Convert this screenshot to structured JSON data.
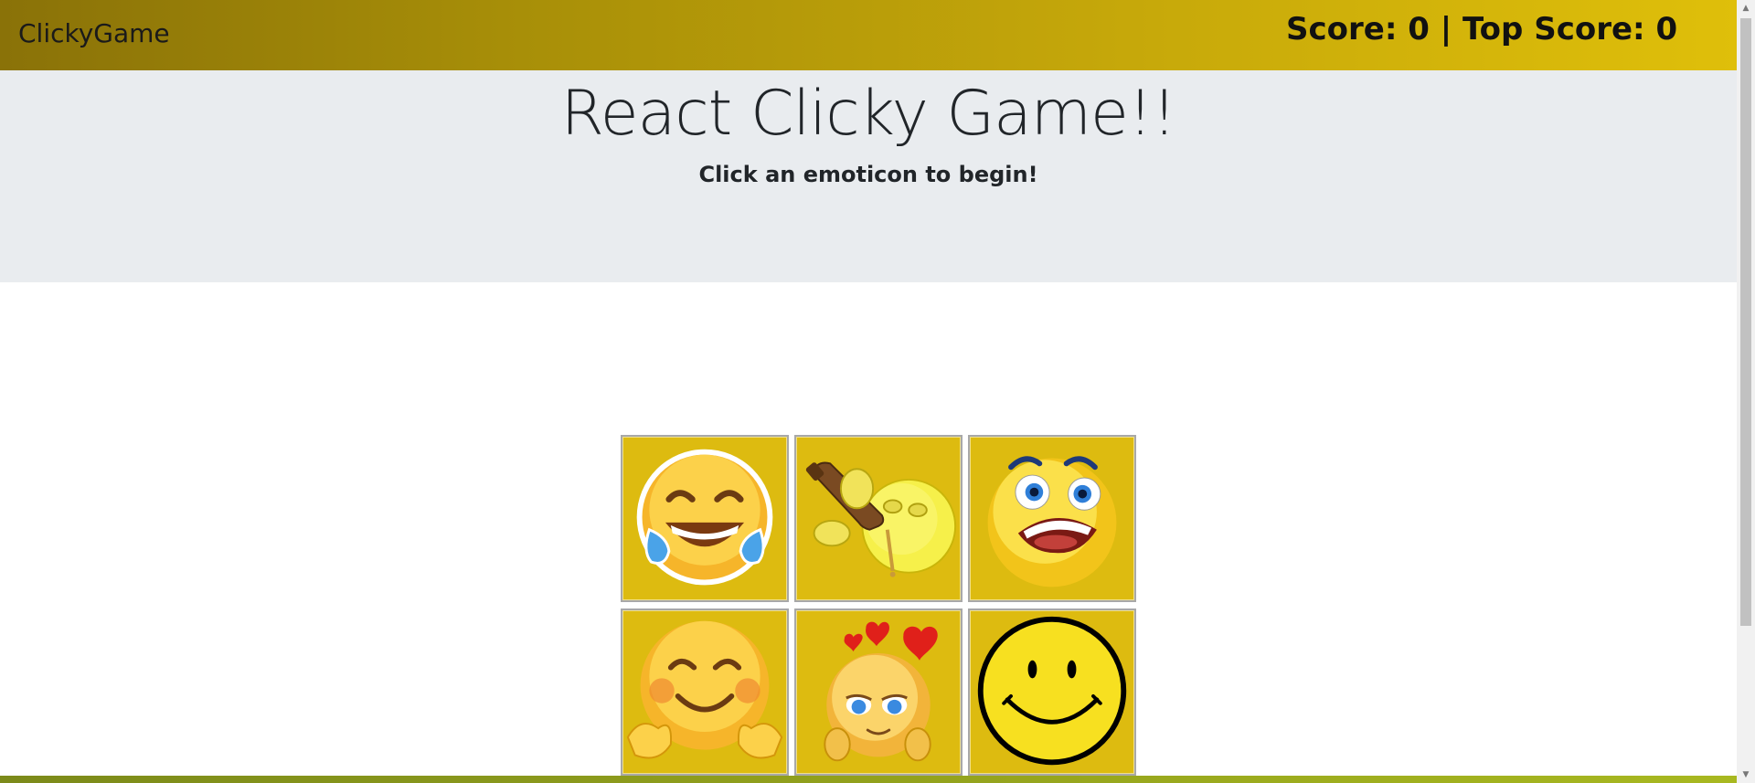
{
  "navbar": {
    "brand": "ClickyGame",
    "score_text": "Score: 0 | Top Score: 0",
    "score": 0,
    "top_score": 0,
    "background_colors": [
      "#8a7208",
      "#dfbf0a"
    ]
  },
  "jumbotron": {
    "title": "React Clicky Game!!",
    "message": "Click an emoticon to begin!",
    "background_color": "#e9ecef"
  },
  "cards": [
    {
      "icon": "laughing-tears-emoji-icon"
    },
    {
      "icon": "drinking-beer-emoji-icon"
    },
    {
      "icon": "scared-emoji-icon"
    },
    {
      "icon": "hugging-blush-emoji-icon"
    },
    {
      "icon": "in-love-hearts-emoji-icon"
    },
    {
      "icon": "classic-smiley-icon"
    }
  ],
  "card_background_color": "#ddbb10"
}
